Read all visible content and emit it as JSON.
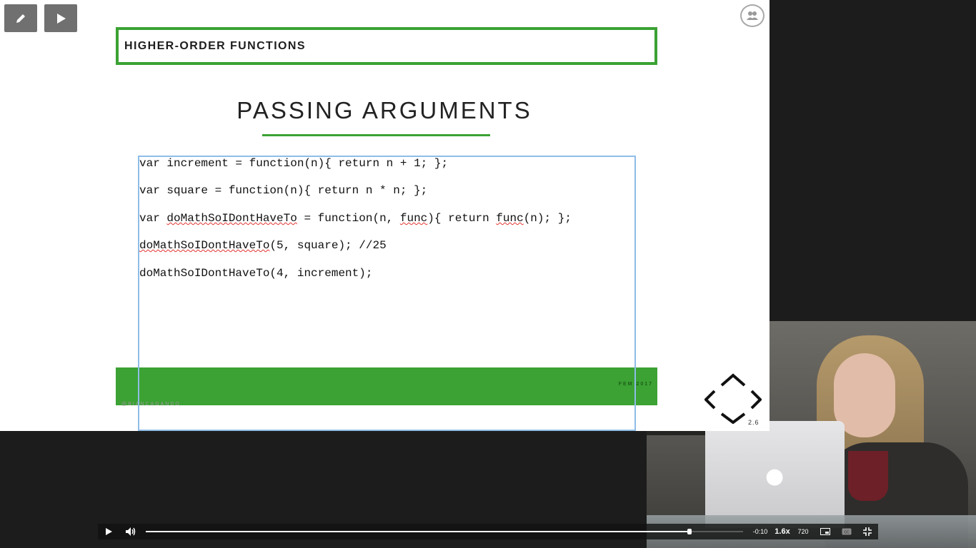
{
  "slide": {
    "header": "HIGHER-ORDER FUNCTIONS",
    "title": "PASSING ARGUMENTS",
    "code": {
      "line1": "var increment = function(n){ return n + 1; };",
      "line2": "var square = function(n){ return n * n; };",
      "line3_a": "var ",
      "line3_b": "doMathSoIDontHaveTo",
      "line3_c": " = function(n, ",
      "line3_d": "func",
      "line3_e": "){ return ",
      "line3_f": "func",
      "line3_g": "(n); };",
      "line4_a": "doMathSoIDontHaveTo",
      "line4_b": "(5, square); //25",
      "line5": "doMathSoIDontHaveTo(4, increment);"
    },
    "footer_right": "FEM 2017",
    "footer_left": "@BIANCAGANDO",
    "version": "2.6"
  },
  "player": {
    "time_remaining": "-0:10",
    "speed": "1.6x",
    "quality": "720",
    "progress": 0.91
  },
  "colors": {
    "accent_green": "#3ba233",
    "selection_blue": "#8fbde8"
  },
  "icons": {
    "pen": "pencil-icon",
    "play_slide": "play-icon",
    "participants": "users-icon",
    "play": "play-icon",
    "volume": "volume-icon",
    "pip": "picture-in-picture-icon",
    "cc": "closed-captions-icon",
    "fullscreen": "exit-fullscreen-icon"
  }
}
